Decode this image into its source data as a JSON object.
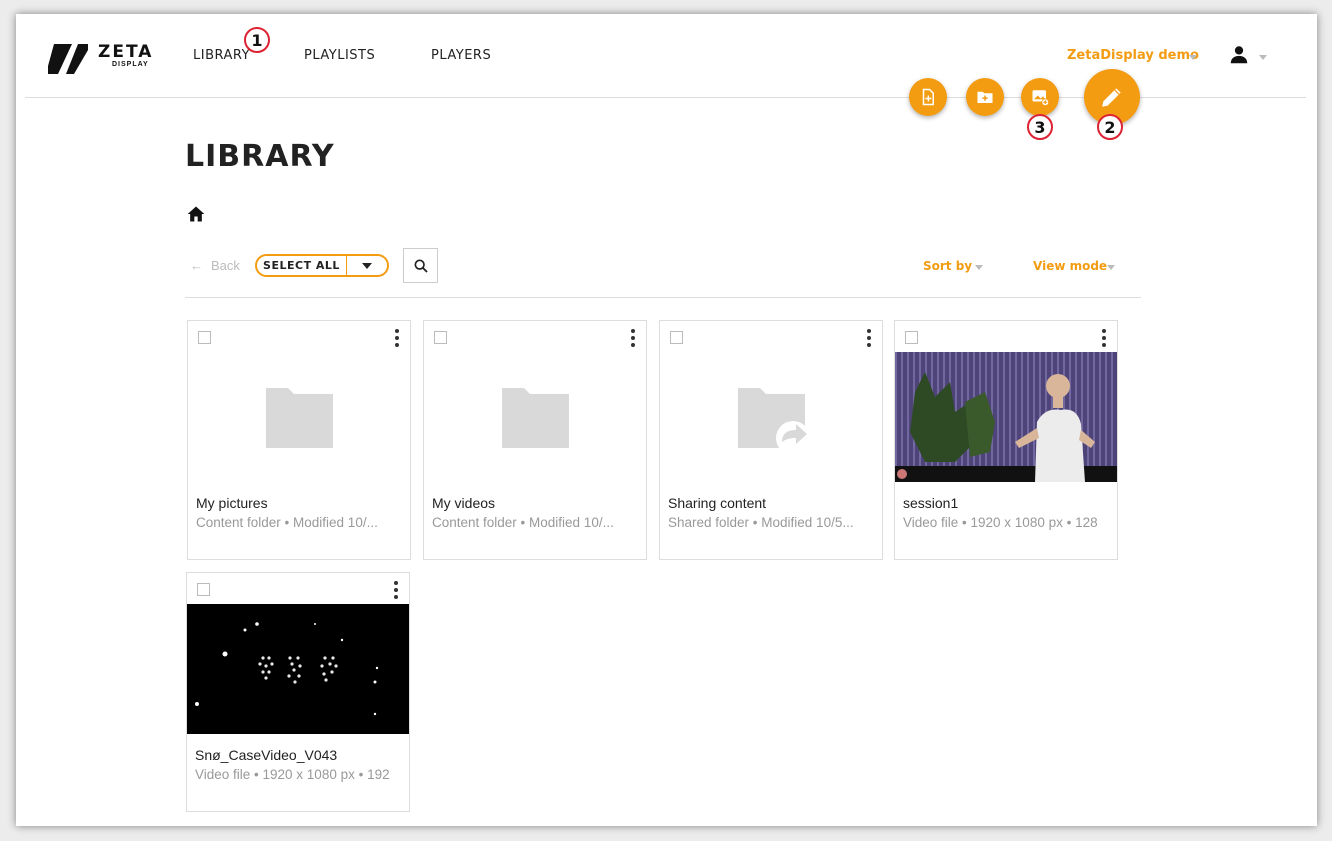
{
  "header": {
    "logo_word": "ZETA",
    "logo_sub": "DISPLAY",
    "nav": [
      {
        "label": "LIBRARY"
      },
      {
        "label": "PLAYLISTS"
      },
      {
        "label": "PLAYERS"
      }
    ],
    "account_label": "ZetaDisplay demo",
    "user_icon": "person-icon"
  },
  "fabs": [
    {
      "icon": "add-file-icon"
    },
    {
      "icon": "add-folder-icon"
    },
    {
      "icon": "add-media-icon"
    },
    {
      "icon": "edit-pencil-icon"
    }
  ],
  "annotations": [
    "1",
    "2",
    "3"
  ],
  "page": {
    "title": "LIBRARY",
    "breadcrumb_icon": "home-icon"
  },
  "toolbar": {
    "back_label": "Back",
    "select_all_label": "SELECT ALL",
    "search_icon": "search-icon",
    "sort_label": "Sort by",
    "view_label": "View mode"
  },
  "items": [
    {
      "name": "My pictures",
      "meta": "Content folder • Modified 10/...",
      "thumb": "folder"
    },
    {
      "name": "My videos",
      "meta": "Content folder • Modified 10/...",
      "thumb": "folder"
    },
    {
      "name": "Sharing content",
      "meta": "Shared folder • Modified 10/5...",
      "thumb": "shared-folder"
    },
    {
      "name": "session1",
      "meta": "Video file • 1920 x 1080 px • 128",
      "thumb": "video-speaker"
    },
    {
      "name": "Snø_CaseVideo_V043",
      "meta": "Video file • 1920 x 1080 px • 192",
      "thumb": "video-snow"
    }
  ],
  "colors": {
    "accent": "#f39c12",
    "folder": "#d9d9d9",
    "badge_border": "#dd2233"
  }
}
